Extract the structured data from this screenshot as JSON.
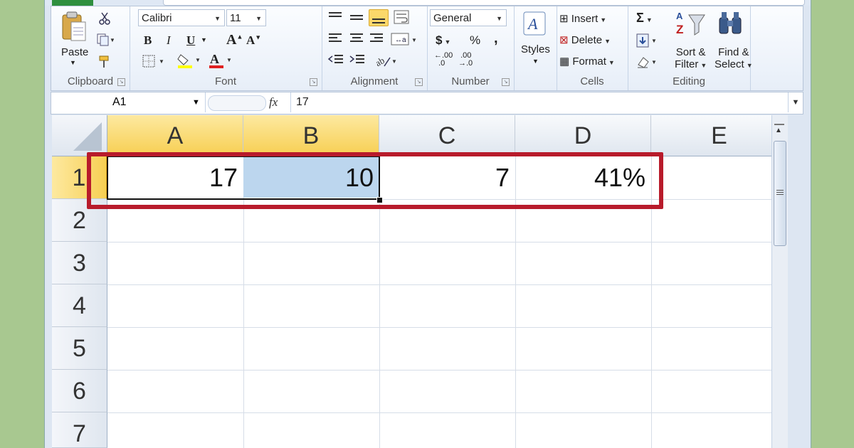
{
  "ribbon": {
    "clipboard": {
      "paste": "Paste",
      "label": "Clipboard"
    },
    "font": {
      "name": "Calibri",
      "size": "11",
      "label": "Font",
      "bold": "B",
      "italic": "I",
      "underline": "U"
    },
    "alignment": {
      "label": "Alignment"
    },
    "number": {
      "format": "General",
      "currency": "$",
      "percent": "%",
      "comma": ",",
      "label": "Number",
      "inc_decimal": ".00",
      "dec_decimal": ".00"
    },
    "styles": {
      "label": "Styles"
    },
    "cells": {
      "insert": "Insert",
      "delete": "Delete",
      "format": "Format",
      "label": "Cells"
    },
    "editing": {
      "sort1": "Sort &",
      "sort2": "Filter",
      "find1": "Find &",
      "find2": "Select",
      "label": "Editing",
      "sum": "Σ"
    }
  },
  "formula_bar": {
    "name_box": "A1",
    "fx": "fx",
    "value": "17"
  },
  "columns": [
    "A",
    "B",
    "C",
    "D",
    "E"
  ],
  "rows": [
    "1",
    "2",
    "3",
    "4",
    "5",
    "6",
    "7"
  ],
  "cells": {
    "A1": "17",
    "B1": "10",
    "C1": "7",
    "D1": "41%"
  },
  "colors": {
    "highlight_box": "#b81b2b",
    "selected_header": "#f7cf53",
    "selected_cell": "#bcd6ee"
  }
}
